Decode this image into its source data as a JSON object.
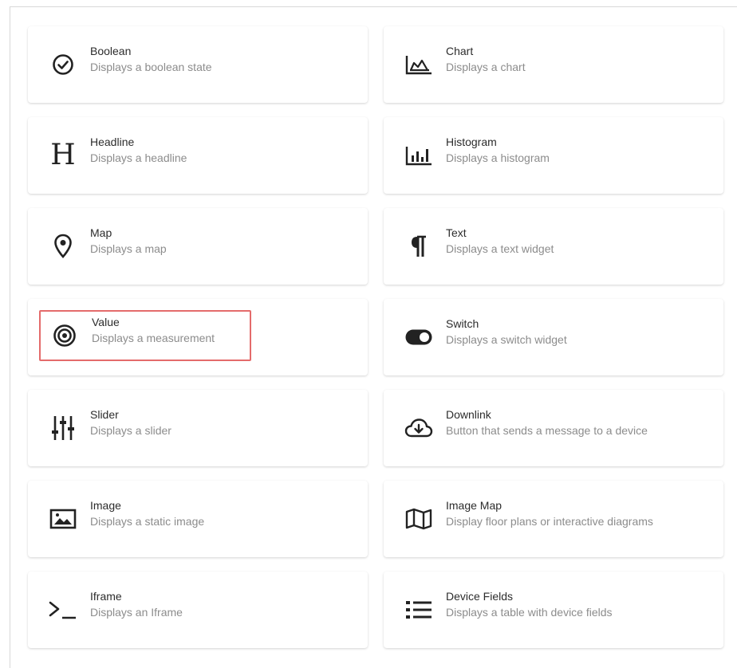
{
  "widgets": [
    {
      "title": "Boolean",
      "description": "Displays a boolean state",
      "icon": "check-circle-icon"
    },
    {
      "title": "Chart",
      "description": "Displays a chart",
      "icon": "area-chart-icon"
    },
    {
      "title": "Headline",
      "description": "Displays a headline",
      "icon": "headline-h-icon"
    },
    {
      "title": "Histogram",
      "description": "Displays a histogram",
      "icon": "histogram-icon"
    },
    {
      "title": "Map",
      "description": "Displays a map",
      "icon": "map-pin-icon"
    },
    {
      "title": "Text",
      "description": "Displays a text widget",
      "icon": "pilcrow-icon"
    },
    {
      "title": "Value",
      "description": "Displays a measurement",
      "icon": "target-icon",
      "selected": true
    },
    {
      "title": "Switch",
      "description": "Displays a switch widget",
      "icon": "toggle-icon"
    },
    {
      "title": "Slider",
      "description": "Displays a slider",
      "icon": "sliders-icon"
    },
    {
      "title": "Downlink",
      "description": "Button that sends a message to a device",
      "icon": "cloud-download-icon"
    },
    {
      "title": "Image",
      "description": "Displays a static image",
      "icon": "image-icon"
    },
    {
      "title": "Image Map",
      "description": "Display floor plans or interactive diagrams",
      "icon": "folded-map-icon"
    },
    {
      "title": "Iframe",
      "description": "Displays an Iframe",
      "icon": "terminal-prompt-icon"
    },
    {
      "title": "Device Fields",
      "description": "Displays a table with device fields",
      "icon": "list-icon"
    }
  ],
  "colors": {
    "selected_border": "#e46b6b",
    "title": "#2c2c2c",
    "description": "#8c8c8c"
  }
}
